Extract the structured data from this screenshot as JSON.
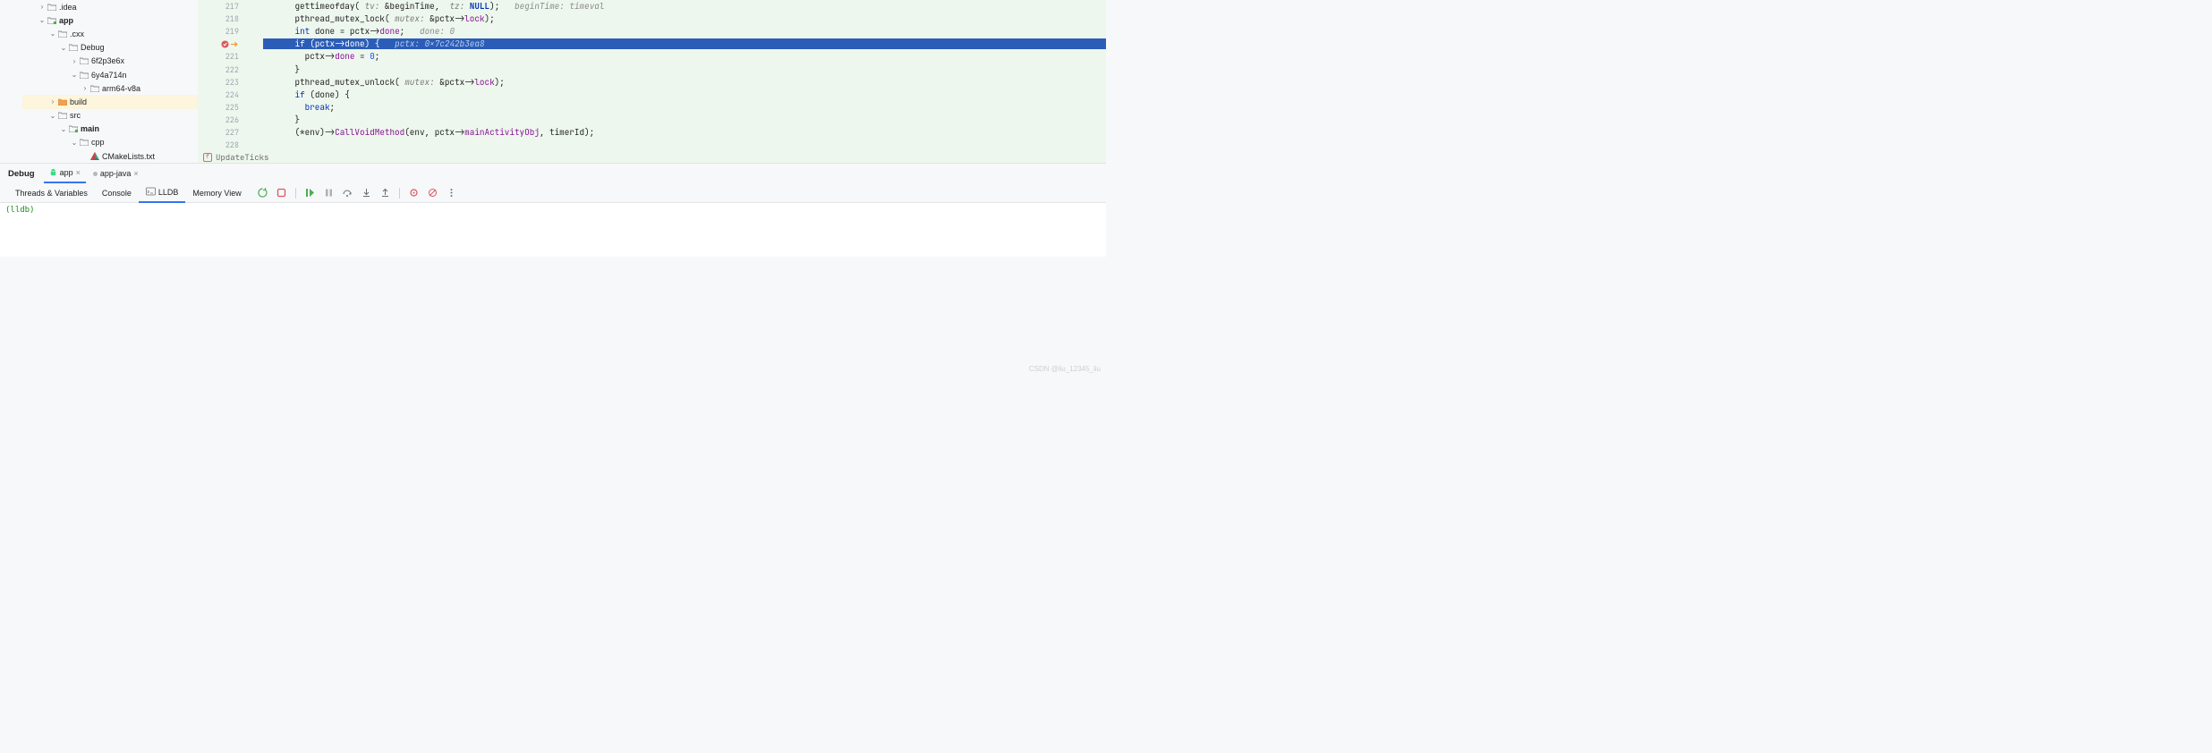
{
  "tree": {
    "idea": ".idea",
    "app": "app",
    "cxx": ".cxx",
    "debug": "Debug",
    "f1": "6f2p3e6x",
    "f2": "6y4a714n",
    "arm": "arm64-v8a",
    "build": "build",
    "src": "src",
    "main": "main",
    "cpp": "cpp",
    "cmake": "CMakeLists.txt"
  },
  "code": {
    "lines": [
      {
        "n": "217",
        "text": "      gettimeofday( ",
        "p1": "tv:",
        "t1": " &beginTime,  ",
        "p2": "tz:",
        "t2": " ",
        "bool": "NULL",
        "t3": ");   ",
        "hint": "beginTime: timeval"
      },
      {
        "n": "218",
        "text": "      pthread_mutex_lock( ",
        "p1": "mutex:",
        "t1": " &pctx->",
        "ptr": "lock",
        "t2": ");"
      },
      {
        "n": "219",
        "kw": "int",
        "t0": " done = pctx->",
        "ptr": "done",
        "t1": ";   ",
        "hint": "done: 0"
      },
      {
        "n": "",
        "current": true,
        "bp": true,
        "kw": "if",
        "t0": " (pctx->",
        "ptr": "done",
        "t1": ") {   ",
        "hint": "pctx: 0x7c242b3ea8"
      },
      {
        "n": "221",
        "t0": "        pctx->",
        "ptr": "done",
        "t1": " = ",
        "num": "0",
        "t2": ";"
      },
      {
        "n": "222",
        "t0": "      }"
      },
      {
        "n": "223",
        "text": "      pthread_mutex_unlock( ",
        "p1": "mutex:",
        "t1": " &pctx->",
        "ptr": "lock",
        "t2": ");"
      },
      {
        "n": "224",
        "kw": "if",
        "t0": " (done) {"
      },
      {
        "n": "225",
        "kw2": "break",
        "t0": ";"
      },
      {
        "n": "226",
        "t0": "      }"
      },
      {
        "n": "227",
        "t0": "      (*env)->",
        "ptr": "CallVoidMethod",
        "t1": "(env, pctx->",
        "ptr2": "mainActivityObj",
        "t2": ", timerId);"
      },
      {
        "n": "228",
        "t0": ""
      }
    ],
    "breadcrumb": "UpdateTicks"
  },
  "debug": {
    "title": "Debug",
    "tabs": {
      "app": "app",
      "app_java": "app-java"
    },
    "subtabs": {
      "threads": "Threads & Variables",
      "console": "Console",
      "lldb": "LLDB",
      "memory": "Memory View"
    },
    "prompt": "(lldb) "
  },
  "watermark": "CSDN @liu_12345_liu"
}
